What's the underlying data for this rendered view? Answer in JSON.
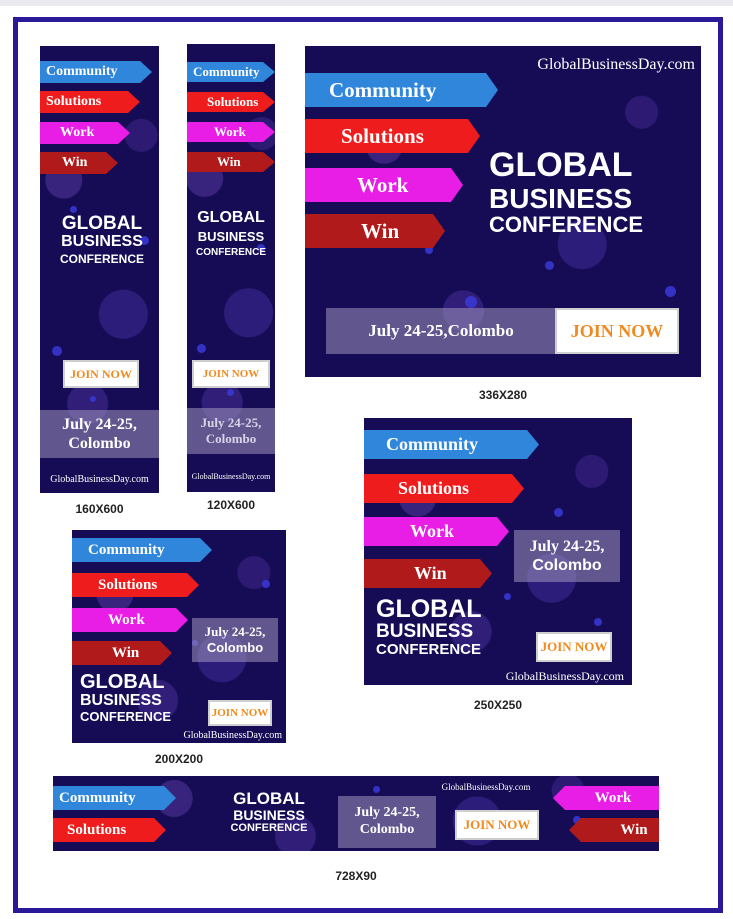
{
  "arrows": {
    "community": "Community",
    "solutions": "Solutions",
    "work": "Work",
    "win": "Win"
  },
  "title": {
    "line1": "GLOBAL",
    "line2": "BUSINESS",
    "line3": "CONFERENCE"
  },
  "date": {
    "full": "July 24-25,Colombo",
    "line1": "July 24-25,",
    "line2": "Colombo"
  },
  "join_label": "JOIN NOW",
  "site": "GlobalBusinessDay.com",
  "captions": {
    "b160": "160X600",
    "b120": "120X600",
    "b336": "336X280",
    "b250": "250X250",
    "b200": "200X200",
    "b728": "728X90"
  },
  "colors": {
    "background": "#150c55",
    "community": "#2f86db",
    "solutions": "#ee1c1c",
    "work": "#e81de6",
    "win": "#b01a1a",
    "join_text": "#f08a1e",
    "frame": "#2a1a9a"
  }
}
